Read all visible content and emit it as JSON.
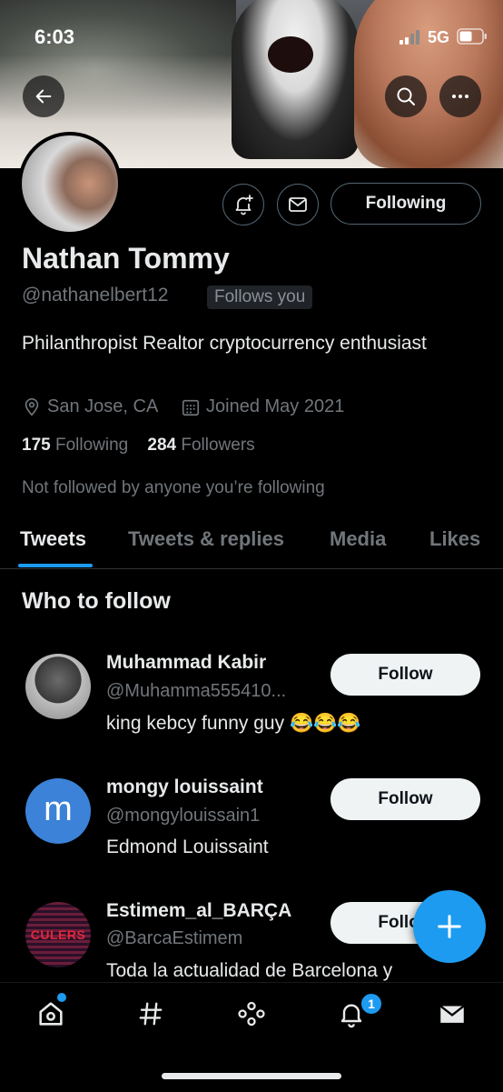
{
  "status_bar": {
    "time": "6:03",
    "network": "5G"
  },
  "profile": {
    "name": "Nathan Tommy",
    "handle": "@nathanelbert12",
    "follows_you": "Follows you",
    "bio": "Philanthropist Realtor cryptocurrency enthusiast",
    "location": "San Jose, CA",
    "joined": "Joined May 2021",
    "following_count": "175",
    "following_label": "Following",
    "followers_count": "284",
    "followers_label": "Followers",
    "not_followed": "Not followed by anyone you’re following",
    "following_button": "Following"
  },
  "tabs": [
    {
      "label": "Tweets",
      "active": true
    },
    {
      "label": "Tweets & replies",
      "active": false
    },
    {
      "label": "Media",
      "active": false
    },
    {
      "label": "Likes",
      "active": false
    }
  ],
  "who_to_follow": {
    "title": "Who to follow",
    "users": [
      {
        "name": "Muhammad Kabir",
        "handle": "@Muhamma555410...",
        "bio": "king kebcy funny guy 😂😂😂",
        "button": "Follow"
      },
      {
        "name": "mongy louissaint",
        "handle": "@mongylouissain1",
        "bio": "Edmond Louissaint",
        "button": "Follow",
        "avatar_letter": "m"
      },
      {
        "name": "Estimem_al_BARÇA",
        "handle": "@BarcaEstimem",
        "bio": "Toda la actualidad de Barcelona y",
        "button": "Follow",
        "avatar_text": "CULERS"
      }
    ]
  },
  "bottom_nav": {
    "items": [
      "home-icon",
      "explore-icon",
      "spaces-icon",
      "notifications-icon",
      "messages-icon"
    ],
    "notification_count": "1"
  },
  "colors": {
    "accent": "#1d9bf0",
    "background": "#000000",
    "secondary_text": "#71767b"
  }
}
